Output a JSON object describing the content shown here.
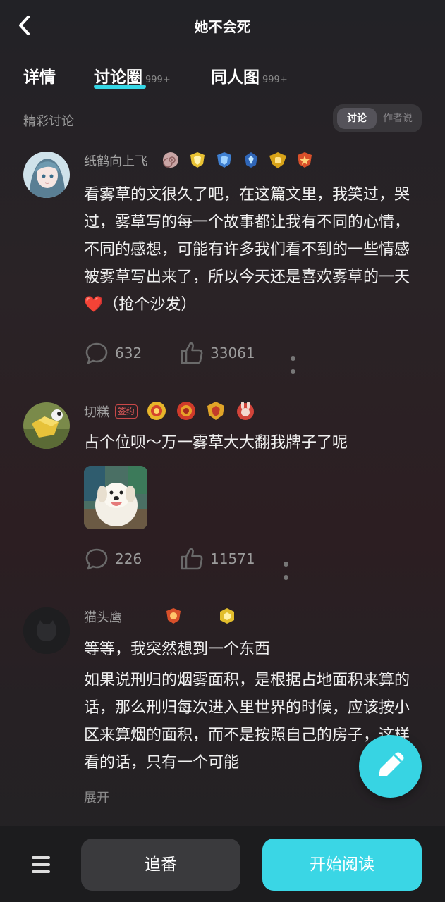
{
  "header": {
    "title": "她不会死",
    "back_icon": "chevron-left-icon"
  },
  "tabs": [
    {
      "label": "详情",
      "count": ""
    },
    {
      "label": "讨论圈",
      "count": "999+"
    },
    {
      "label": "同人图",
      "count": "999+"
    }
  ],
  "section": {
    "title": "精彩讨论",
    "toggle": {
      "active": "讨论",
      "inactive": "作者说"
    }
  },
  "posts": [
    {
      "username": "纸鹤向上飞",
      "text": "看雾草的文很久了吧，在这篇文里，我笑过，哭过，雾草写的每一个故事都让我有不同的心情，不同的感想，可能有许多我们看不到的一些情感被雾草写出来了，所以今天还是喜欢雾草的一天❤️（抢个沙发）",
      "comments": "632",
      "likes": "33061"
    },
    {
      "username": "切糕",
      "tag": "签约",
      "text": "占个位呗～万一雾草大大翻我牌子了呢",
      "comments": "226",
      "likes": "11571"
    },
    {
      "username": "猫头鹰",
      "line1": "等等，我突然想到一个东西",
      "text": "如果说刑归的烟雾面积，是根据占地面积来算的话，那么刑归每次进入里世界的时候，应该按小区来算烟的面积，而不是按照自己的房子，这样看的话，只有一个可能",
      "expand": "展开"
    }
  ],
  "bottom": {
    "follow_label": "追番",
    "read_label": "开始阅读",
    "menu_icon": "menu-icon",
    "edit_icon": "pencil-icon"
  },
  "colors": {
    "accent": "#37d4e3",
    "background": "#232225"
  }
}
